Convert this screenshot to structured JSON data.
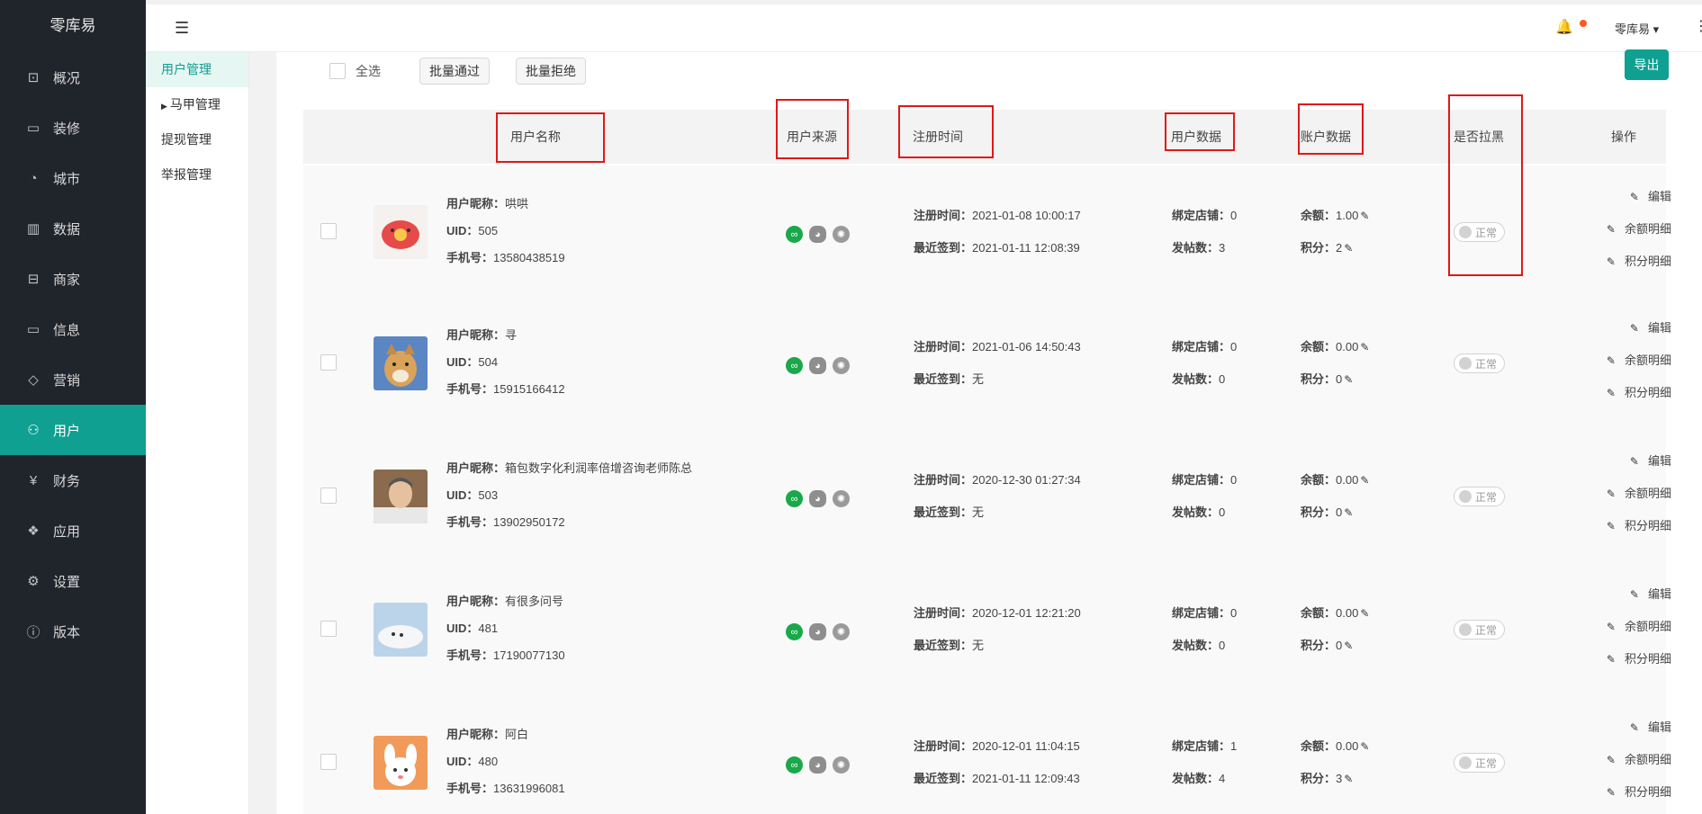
{
  "brand": "零库易",
  "sidebar": [
    {
      "label": "概况",
      "icon": "overview-icon",
      "glyph": "⊡",
      "active": false
    },
    {
      "label": "装修",
      "icon": "decoration-icon",
      "glyph": "▭",
      "active": false
    },
    {
      "label": "城市",
      "icon": "city-icon",
      "glyph": "◔",
      "active": false
    },
    {
      "label": "数据",
      "icon": "data-icon",
      "glyph": "▥",
      "active": false
    },
    {
      "label": "商家",
      "icon": "store-icon",
      "glyph": "⊟",
      "active": false
    },
    {
      "label": "信息",
      "icon": "message-icon",
      "glyph": "▭",
      "active": false
    },
    {
      "label": "营销",
      "icon": "tag-icon",
      "glyph": "◇",
      "active": false
    },
    {
      "label": "用户",
      "icon": "user-icon",
      "glyph": "⚇",
      "active": true
    },
    {
      "label": "财务",
      "icon": "finance-icon",
      "glyph": "¥",
      "active": false
    },
    {
      "label": "应用",
      "icon": "apps-icon",
      "glyph": "❖",
      "active": false
    },
    {
      "label": "设置",
      "icon": "settings-icon",
      "glyph": "⚙",
      "active": false
    },
    {
      "label": "版本",
      "icon": "info-icon",
      "glyph": "ⓘ",
      "active": false
    }
  ],
  "subnav": [
    {
      "label": "用户管理",
      "active": true,
      "caret": false
    },
    {
      "label": "马甲管理",
      "active": false,
      "caret": true
    },
    {
      "label": "提现管理",
      "active": false,
      "caret": false
    },
    {
      "label": "举报管理",
      "active": false,
      "caret": false
    }
  ],
  "topbar": {
    "user": "零库易",
    "user_caret": "▾",
    "fold_glyph": "☰",
    "bell_glyph": "🔔",
    "more_glyph": "⋮"
  },
  "toolbar": {
    "select_all": "全选",
    "batch_approve": "批量通过",
    "batch_reject": "批量拒绝",
    "export": "导出"
  },
  "columns": {
    "name": "用户名称",
    "source": "用户来源",
    "reg": "注册时间",
    "user_data": "用户数据",
    "account": "账户数据",
    "blacklist": "是否拉黑",
    "ops": "操作"
  },
  "labels": {
    "nickname": "用户昵称：",
    "uid": "UID：",
    "phone": "手机号：",
    "reg_time": "注册时间：",
    "last_sign": "最近签到：",
    "bound_stores": "绑定店铺：",
    "posts": "发帖数：",
    "balance": "余额：",
    "points": "积分：",
    "status": "正常",
    "op_edit": "编辑",
    "op_balance": "余额明细",
    "op_points": "积分明细"
  },
  "users": [
    {
      "nickname": "哄哄",
      "uid": "505",
      "phone": "13580438519",
      "reg_time": "2021-01-08 10:00:17",
      "last_sign": "2021-01-11 12:08:39",
      "bound_stores": "0",
      "posts": "3",
      "balance": "1.00",
      "points": "2",
      "avatar": "pig"
    },
    {
      "nickname": "寻",
      "uid": "504",
      "phone": "15915166412",
      "reg_time": "2021-01-06 14:50:43",
      "last_sign": "无",
      "bound_stores": "0",
      "posts": "0",
      "balance": "0.00",
      "points": "0",
      "avatar": "dog"
    },
    {
      "nickname": "箱包数字化利润率倍增咨询老师陈总",
      "uid": "503",
      "phone": "13902950172",
      "reg_time": "2020-12-30 01:27:34",
      "last_sign": "无",
      "bound_stores": "0",
      "posts": "0",
      "balance": "0.00",
      "points": "0",
      "avatar": "man"
    },
    {
      "nickname": "有很多问号",
      "uid": "481",
      "phone": "17190077130",
      "reg_time": "2020-12-01 12:21:20",
      "last_sign": "无",
      "bound_stores": "0",
      "posts": "0",
      "balance": "0.00",
      "points": "0",
      "avatar": "seal"
    },
    {
      "nickname": "阿白",
      "uid": "480",
      "phone": "13631996081",
      "reg_time": "2020-12-01 11:04:15",
      "last_sign": "2021-01-11 12:09:43",
      "bound_stores": "1",
      "posts": "4",
      "balance": "0.00",
      "points": "3",
      "avatar": "bunny"
    }
  ]
}
